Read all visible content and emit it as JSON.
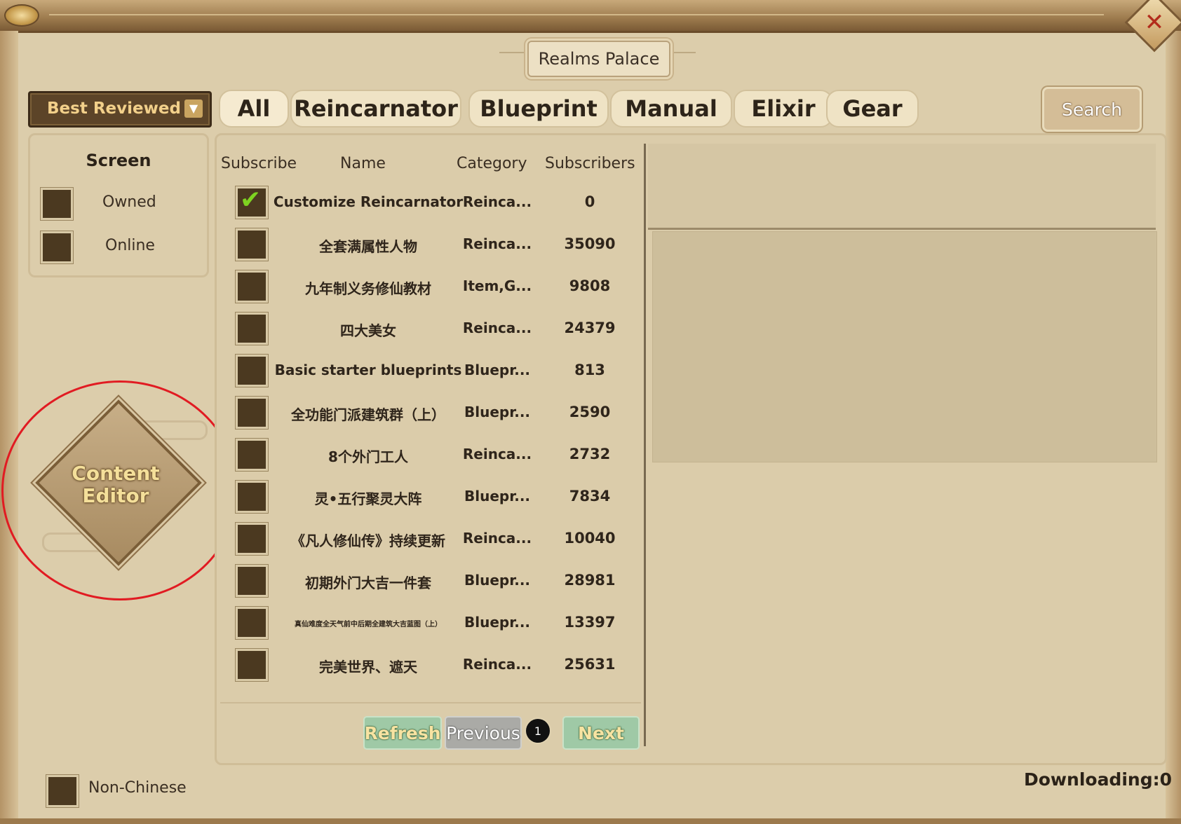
{
  "window": {
    "title": "Realms Palace"
  },
  "sort": {
    "selected": "Best Reviewed"
  },
  "tabs": [
    {
      "label": "All",
      "active": true
    },
    {
      "label": "Reincarnator",
      "active": false
    },
    {
      "label": "Blueprint",
      "active": false
    },
    {
      "label": "Manual",
      "active": false
    },
    {
      "label": "Elixir",
      "active": false
    },
    {
      "label": "Gear",
      "active": false
    }
  ],
  "search": {
    "label": "Search"
  },
  "screen": {
    "title": "Screen",
    "options": [
      {
        "label": "Owned",
        "checked": false
      },
      {
        "label": "Online",
        "checked": false
      }
    ]
  },
  "editor": {
    "line1": "Content",
    "line2": "Editor"
  },
  "list": {
    "headers": {
      "subscribe": "Subscribe",
      "name": "Name",
      "category": "Category",
      "subscribers": "Subscribers"
    },
    "rows": [
      {
        "subscribed": true,
        "name": "Customize Reincarnator",
        "category": "Reinca...",
        "subscribers": "0"
      },
      {
        "subscribed": false,
        "name": "全套满属性人物",
        "category": "Reinca...",
        "subscribers": "35090"
      },
      {
        "subscribed": false,
        "name": "九年制义务修仙教材",
        "category": "Item,G...",
        "subscribers": "9808"
      },
      {
        "subscribed": false,
        "name": "四大美女",
        "category": "Reinca...",
        "subscribers": "24379"
      },
      {
        "subscribed": false,
        "name": "Basic starter blueprints",
        "category": "Bluepr...",
        "subscribers": "813"
      },
      {
        "subscribed": false,
        "name": "全功能门派建筑群（上）",
        "category": "Bluepr...",
        "subscribers": "2590"
      },
      {
        "subscribed": false,
        "name": "8个外门工人",
        "category": "Reinca...",
        "subscribers": "2732"
      },
      {
        "subscribed": false,
        "name": "灵•五行聚灵大阵",
        "category": "Bluepr...",
        "subscribers": "7834"
      },
      {
        "subscribed": false,
        "name": "《凡人修仙传》持续更新",
        "category": "Reinca...",
        "subscribers": "10040"
      },
      {
        "subscribed": false,
        "name": "初期外门大吉一件套",
        "category": "Bluepr...",
        "subscribers": "28981"
      },
      {
        "subscribed": false,
        "name": "真仙难度全天气前中后期全建筑大吉蓝图（上）",
        "category": "Bluepr...",
        "subscribers": "13397"
      },
      {
        "subscribed": false,
        "name": "完美世界、遮天",
        "category": "Reinca...",
        "subscribers": "25631"
      }
    ]
  },
  "pagination": {
    "refresh": "Refresh",
    "previous": "Previous",
    "page": "1",
    "next": "Next"
  },
  "footer": {
    "non_chinese": "Non-Chinese",
    "downloading": "Downloading:0"
  }
}
